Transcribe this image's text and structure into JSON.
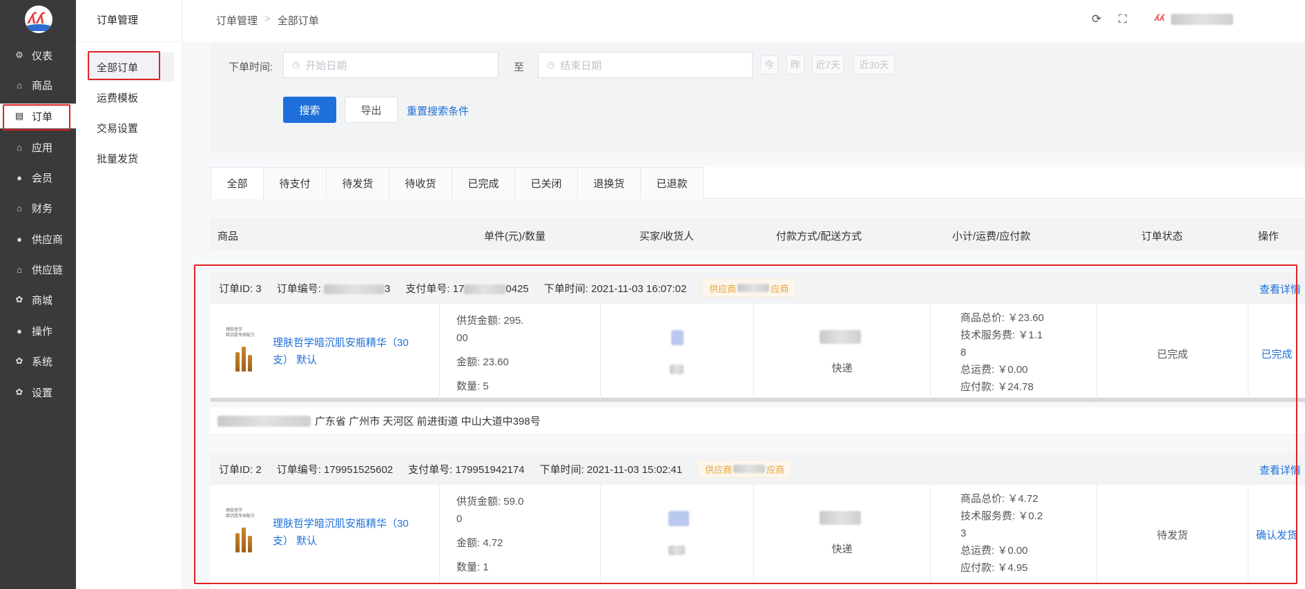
{
  "nav": {
    "items": [
      {
        "icon": "dashboard-icon",
        "glyph": "⚙",
        "label": "仪表"
      },
      {
        "icon": "bag-icon",
        "glyph": "⌂",
        "label": "商品"
      },
      {
        "icon": "order-icon",
        "glyph": "▤",
        "label": "订单"
      },
      {
        "icon": "bag-icon",
        "glyph": "⌂",
        "label": "应用"
      },
      {
        "icon": "user-icon",
        "glyph": "●",
        "label": "会员"
      },
      {
        "icon": "bag-icon",
        "glyph": "⌂",
        "label": "财务"
      },
      {
        "icon": "user-icon",
        "glyph": "●",
        "label": "供应商"
      },
      {
        "icon": "bag-icon",
        "glyph": "⌂",
        "label": "供应链"
      },
      {
        "icon": "gear-icon",
        "glyph": "✿",
        "label": "商城"
      },
      {
        "icon": "user-icon",
        "glyph": "●",
        "label": "操作"
      },
      {
        "icon": "gear-icon",
        "glyph": "✿",
        "label": "系统"
      },
      {
        "icon": "gear-icon",
        "glyph": "✿",
        "label": "设置"
      }
    ],
    "active_index": 2
  },
  "subnav": {
    "title": "订单管理",
    "items": [
      "全部订单",
      "运费模板",
      "交易设置",
      "批量发货"
    ]
  },
  "breadcrumb": {
    "root": "订单管理",
    "sep": ">",
    "current": "全部订单"
  },
  "header": {
    "refresh_icon": "⟳",
    "fullscreen_icon": "⛶"
  },
  "search": {
    "time_label": "下单时间:",
    "start_placeholder": "开始日期",
    "to_label": "至",
    "end_placeholder": "结束日期",
    "quick": [
      "今",
      "昨",
      "近7天",
      "近30天"
    ],
    "search_btn": "搜索",
    "export_btn": "导出",
    "reset_link": "重置搜索条件"
  },
  "tabs": [
    "全部",
    "待支付",
    "待发货",
    "待收货",
    "已完成",
    "已关闭",
    "退换货",
    "已退款"
  ],
  "table_headers": [
    "商品",
    "单件(元)/数量",
    "买家/收货人",
    "付款方式/配送方式",
    "小计/运费/应付款",
    "订单状态",
    "操作"
  ],
  "orders": [
    {
      "order_id": "订单ID: 3",
      "order_no_label": "订单编号:",
      "order_no_suffix": "3",
      "pay_no_label": "支付单号: 17",
      "pay_no_suffix": "0425",
      "time": "下单时间: 2021-11-03 16:07:02",
      "supplier_prefix": "供应商",
      "supplier_suffix": "应商",
      "view_detail": "查看详情",
      "product_name": "理肤哲学暗沉肌安瓶精华（30支） 默认",
      "supply_amount_1": "供货金额: 295.",
      "supply_amount_2": "00",
      "amount": "金额: 23.60",
      "qty": "数量: 5",
      "delivery": "快递",
      "goods_total": "商品总价: ￥23.60",
      "service_fee_1": "技术服务费: ￥1.1",
      "service_fee_2": "8",
      "shipping": "总运费: ￥0.00",
      "payable": "应付款: ￥24.78",
      "status": "已完成",
      "action": "已完成",
      "address": "广东省 广州市 天河区 前进街道 中山大道中398号"
    },
    {
      "order_id": "订单ID: 2",
      "order_no_label": "订单编号: 179951525602",
      "order_no_suffix": "",
      "pay_no_label": "支付单号: 179951942174",
      "pay_no_suffix": "",
      "time": "下单时间: 2021-11-03 15:02:41",
      "supplier_prefix": "供应商",
      "supplier_suffix": "应商",
      "view_detail": "查看详情",
      "product_name": "理肤哲学暗沉肌安瓶精华（30支） 默认",
      "supply_amount_1": "供货金额: 59.0",
      "supply_amount_2": "0",
      "amount": "金额: 4.72",
      "qty": "数量: 1",
      "delivery": "快递",
      "goods_total": "商品总价: ￥4.72",
      "service_fee_1": "技术服务费: ￥0.2",
      "service_fee_2": "3",
      "shipping": "总运费: ￥0.00",
      "payable": "应付款: ￥4.95",
      "status": "待发货",
      "action": "确认发货"
    }
  ],
  "thumb_text": {
    "line1": "理肤哲学",
    "line2": "暗沉肌专研配方"
  },
  "colors": {
    "accent": "#1e6fd9",
    "highlight": "#e02020",
    "sidebar": "#3a3a3a",
    "badge": "#e6a23c"
  }
}
